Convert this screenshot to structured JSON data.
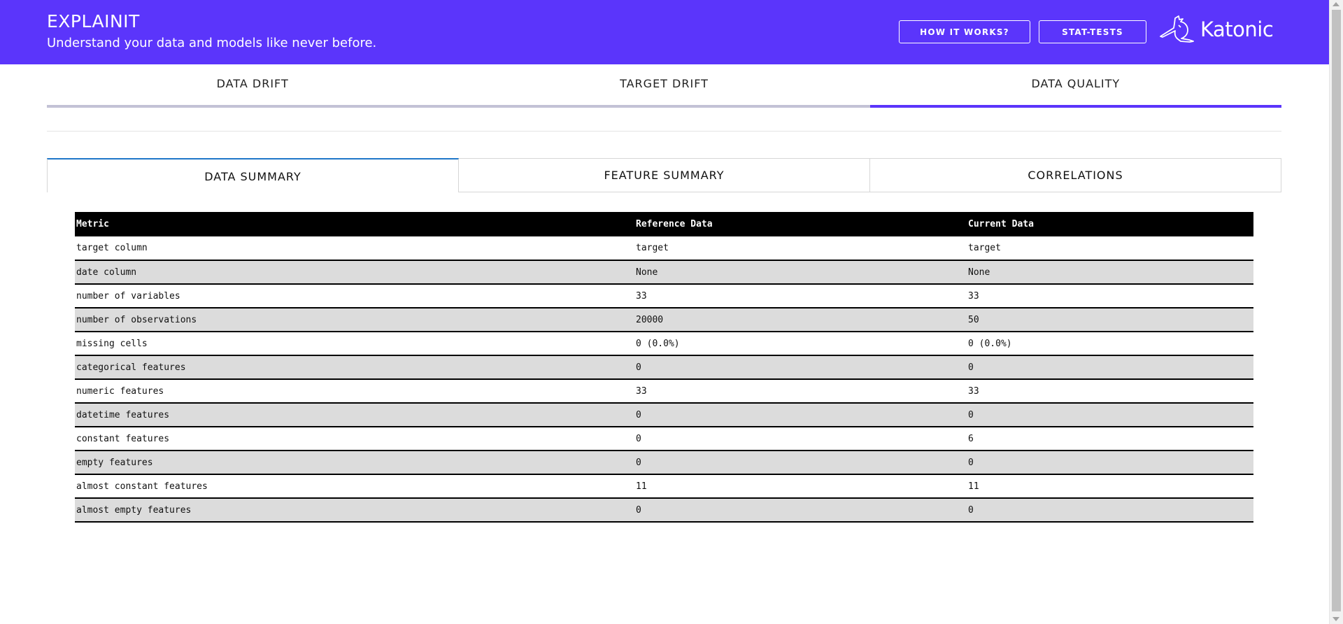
{
  "header": {
    "title": "EXPLAINIT",
    "subtitle": "Understand your data and models like never before.",
    "buttons": {
      "how_it_works": "HOW IT WORKS?",
      "stat_tests": "STAT-TESTS"
    },
    "logo_text": "Katonic",
    "logo_icon": "kangaroo-icon",
    "brand_color": "#5b35fb"
  },
  "top_tabs": [
    {
      "label": "DATA DRIFT",
      "active": false
    },
    {
      "label": "TARGET DRIFT",
      "active": false
    },
    {
      "label": "DATA QUALITY",
      "active": true
    }
  ],
  "sub_tabs": [
    {
      "label": "DATA SUMMARY",
      "active": true
    },
    {
      "label": "FEATURE SUMMARY",
      "active": false
    },
    {
      "label": "CORRELATIONS",
      "active": false
    }
  ],
  "table": {
    "headers": [
      "Metric",
      "Reference Data",
      "Current Data"
    ],
    "rows": [
      [
        "target column",
        "target",
        "target"
      ],
      [
        "date column",
        "None",
        "None"
      ],
      [
        "number of variables",
        "33",
        "33"
      ],
      [
        "number of observations",
        "20000",
        "50"
      ],
      [
        "missing cells",
        "0 (0.0%)",
        "0 (0.0%)"
      ],
      [
        "categorical features",
        "0",
        "0"
      ],
      [
        "numeric features",
        "33",
        "33"
      ],
      [
        "datetime features",
        "0",
        "0"
      ],
      [
        "constant features",
        "0",
        "6"
      ],
      [
        "empty features",
        "0",
        "0"
      ],
      [
        "almost constant features",
        "11",
        "11"
      ],
      [
        "almost empty features",
        "0",
        "0"
      ]
    ]
  }
}
